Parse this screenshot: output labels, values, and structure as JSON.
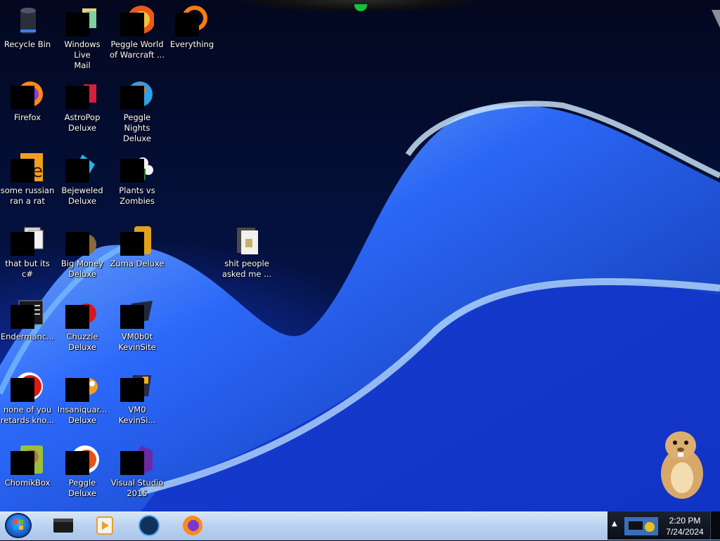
{
  "desktop": {
    "icons": [
      {
        "label": "Recycle Bin",
        "icon": "recycle-bin-icon"
      },
      {
        "label": "Windows Live\nMail",
        "icon": "mail-icon"
      },
      {
        "label": "Peggle World\nof Warcraft ...",
        "icon": "peggle-icon"
      },
      {
        "label": "Everything",
        "icon": "everything-search-icon"
      },
      {
        "label": "Firefox",
        "icon": "firefox-icon"
      },
      {
        "label": "AstroPop\nDeluxe",
        "icon": "astropop-icon"
      },
      {
        "label": "Peggle Nights\nDeluxe",
        "icon": "peggle-nights-icon"
      },
      {
        "label": "some russian\nran a rat",
        "icon": "document-icon"
      },
      {
        "label": "Bejeweled\nDeluxe",
        "icon": "bejeweled-icon"
      },
      {
        "label": "Plants vs\nZombies",
        "icon": "plants-vs-zombies-icon"
      },
      {
        "label": "that but its c#",
        "icon": "document-stack-icon"
      },
      {
        "label": "Big Money\nDeluxe",
        "icon": "money-bag-icon"
      },
      {
        "label": "Zuma Deluxe",
        "icon": "zuma-icon"
      },
      {
        "label": "shit people\nasked me ...",
        "icon": "folder-icon"
      },
      {
        "label": "Endermanc...",
        "icon": "terminal-icon"
      },
      {
        "label": "Chuzzle\nDeluxe",
        "icon": "chuzzle-icon"
      },
      {
        "label": "VM0b0t\nKevinSite",
        "icon": "vm-icon"
      },
      {
        "label": "none of you\nretards kno...",
        "icon": "red-circle-icon"
      },
      {
        "label": "Insaniquar...\nDeluxe",
        "icon": "fish-icon"
      },
      {
        "label": "VM0\nKevinSi...",
        "icon": "vm2-icon"
      },
      {
        "label": "ChomikBox",
        "icon": "hamster-box-icon"
      },
      {
        "label": "Peggle Deluxe",
        "icon": "peggle-deluxe-icon"
      },
      {
        "label": "Visual Studio\n2015",
        "icon": "visual-studio-icon"
      }
    ]
  },
  "taskbar": {
    "start": "start-orb-icon",
    "pinned": [
      "media-player-box-icon",
      "media-center-icon",
      "globe-icon",
      "firefox-icon"
    ],
    "tray": {
      "time": "2:20 PM",
      "date": "7/24/2024",
      "arrow": "▲"
    }
  },
  "colors": {
    "taskbar": "#c3d8f2",
    "wallpaper_dark": "#03081f",
    "wallpaper_blue": "#1f4fe0"
  }
}
